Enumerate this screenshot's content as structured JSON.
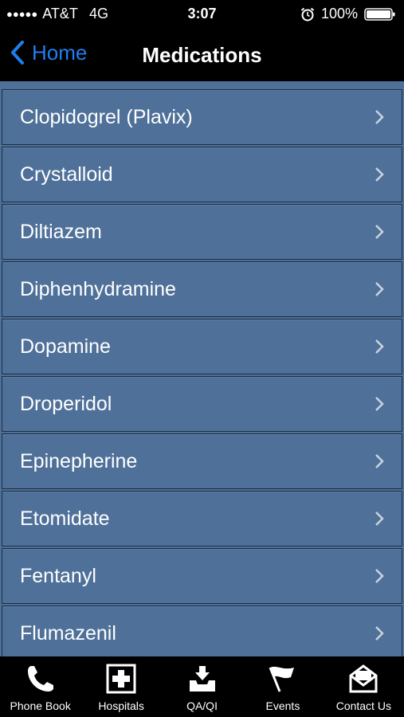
{
  "status_bar": {
    "signal_dots": "●●●●●",
    "carrier": "AT&T",
    "network": "4G",
    "time": "3:07",
    "battery": "100%"
  },
  "nav": {
    "back_label": "Home",
    "title": "Medications",
    "accent_color": "#1f7ff0"
  },
  "medications": [
    "Clopidogrel (Plavix)",
    "Crystalloid",
    "Diltiazem",
    "Diphenhydramine",
    "Dopamine",
    "Droperidol",
    "Epinepherine",
    "Etomidate",
    "Fentanyl",
    "Flumazenil"
  ],
  "tab_bar": {
    "tabs": [
      {
        "label": "Phone Book",
        "icon": "phone-icon"
      },
      {
        "label": "Hospitals",
        "icon": "hospital-cross-icon"
      },
      {
        "label": "QA/QI",
        "icon": "inbox-download-icon"
      },
      {
        "label": "Events",
        "icon": "flag-icon"
      },
      {
        "label": "Contact Us",
        "icon": "envelope-icon"
      }
    ]
  },
  "colors": {
    "list_background": "#4f7199",
    "row_border": "#1c2c42",
    "bar_background": "#000000"
  }
}
